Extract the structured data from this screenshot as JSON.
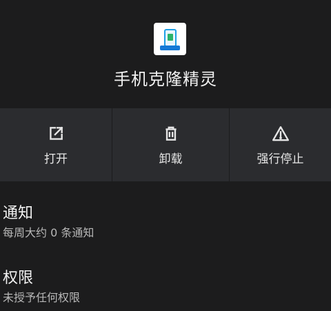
{
  "app": {
    "name": "手机克隆精灵",
    "icon": "phone-clone-app-icon"
  },
  "actions": [
    {
      "label": "打开",
      "icon": "open-external-icon"
    },
    {
      "label": "卸载",
      "icon": "trash-icon"
    },
    {
      "label": "强行停止",
      "icon": "warning-icon"
    }
  ],
  "settings": {
    "notifications": {
      "title": "通知",
      "summary": "每周大约 0 条通知"
    },
    "permissions": {
      "title": "权限",
      "summary": "未授予任何权限"
    }
  },
  "colors": {
    "background": "#1c1c1d",
    "button_background": "#2b2c2f",
    "text_primary": "#f2f2f2",
    "text_secondary": "#b8b8b8"
  }
}
